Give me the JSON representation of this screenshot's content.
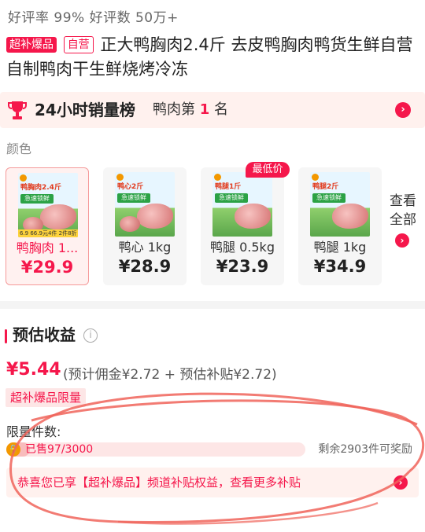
{
  "stats": {
    "text": "好评率 99%  好评数 50万+"
  },
  "product": {
    "tags": [
      "超补爆品",
      "自营"
    ],
    "title": "正大鸭胸肉2.4斤 去皮鸭胸肉鸭货生鲜自营自制鸭肉干生鲜烧烤冷冻"
  },
  "ranking": {
    "title": "24小时销量榜",
    "sub_prefix": "鸭肉第",
    "rank_number": "1",
    "sub_suffix": "名"
  },
  "color_label": "颜色",
  "variants": [
    {
      "name": "鸭胸肉 1...",
      "price": "¥29.9",
      "selected": true,
      "img_badge": "鸭胸肉2.4斤",
      "img_banner": "急速锁鲜",
      "img_strip": "6.9  66.9元4件 2件8折 3件7折"
    },
    {
      "name": "鸭心 1kg",
      "price": "¥28.9",
      "selected": false,
      "img_badge": "鸭心2斤",
      "img_banner": "急速锁鲜",
      "img_strip": ""
    },
    {
      "name": "鸭腿 0.5kg",
      "price": "¥23.9",
      "selected": false,
      "img_badge": "鸭腿1斤",
      "img_banner": "急速锁鲜",
      "img_strip": ""
    },
    {
      "name": "鸭腿 1kg",
      "price": "¥34.9",
      "selected": false,
      "img_badge": "鸭腿2斤",
      "img_banner": "急速锁鲜",
      "img_strip": ""
    }
  ],
  "lowest_price_tag": "最低价",
  "view_all": "查看全部",
  "estimate": {
    "title": "预估收益",
    "amount": "¥5.44",
    "detail": "(预计佣金¥2.72 + 预估补贴¥2.72)",
    "limit_tag": "超补爆品限量",
    "limit_label": "限量件数:",
    "sold_text": "已售97/3000",
    "sold_fraction": 0.032,
    "remaining_text": "剩余2903件可奖励",
    "promo_text": "恭喜您已享【超补爆品】频道补贴权益，查看更多补贴"
  },
  "colors": {
    "accent": "#f5174b",
    "light_bg": "#fff1ee",
    "annotation": "#f0645a"
  }
}
